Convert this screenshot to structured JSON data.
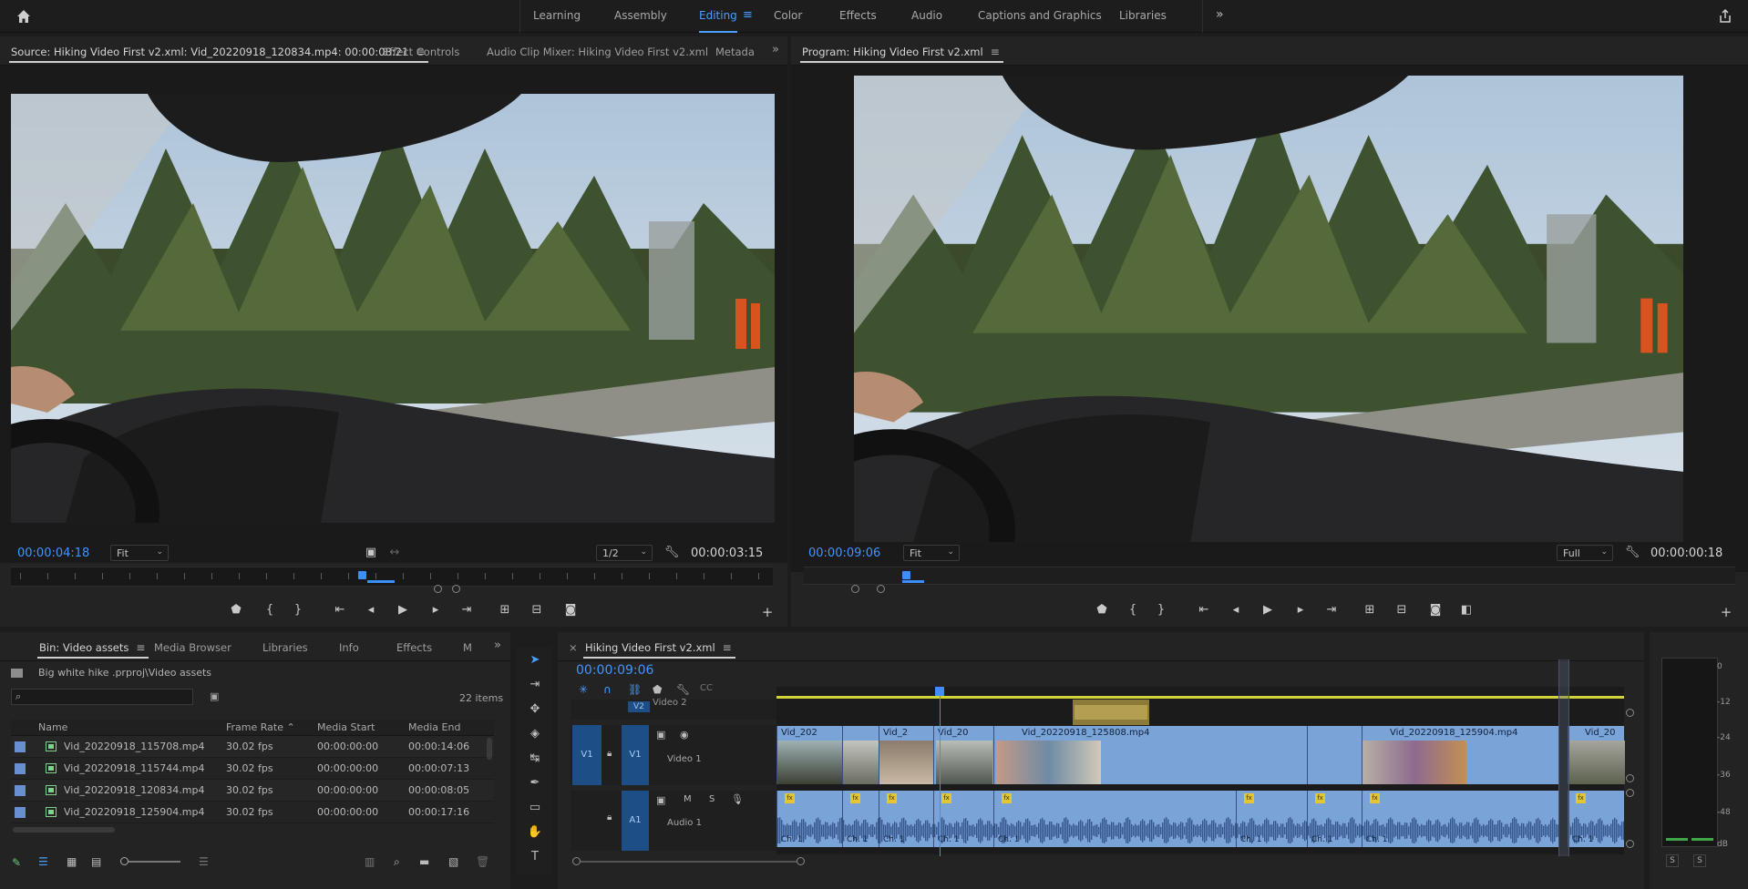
{
  "workspaces": {
    "tabs": [
      "Learning",
      "Assembly",
      "Editing",
      "Color",
      "Effects",
      "Audio",
      "Captions and Graphics",
      "Libraries"
    ],
    "active": "Editing"
  },
  "source": {
    "tabs": {
      "source": "Source: Hiking Video First v2.xml: Vid_20220918_120834.mp4: 00:00:08:21",
      "effect_controls": "Effect Controls",
      "audio_mixer": "Audio Clip Mixer: Hiking Video First v2.xml",
      "metadata": "Metada"
    },
    "timecode": "00:00:04:18",
    "fit": "Fit",
    "resolution": "1/2",
    "duration": "00:00:03:15",
    "playhead_fraction": 0.46
  },
  "program": {
    "title": "Program: Hiking Video First v2.xml",
    "timecode": "00:00:09:06",
    "fit": "Fit",
    "resolution": "Full",
    "duration": "00:00:00:18"
  },
  "project": {
    "tabs": {
      "bin": "Bin: Video assets",
      "media_browser": "Media Browser",
      "libraries": "Libraries",
      "info": "Info",
      "effects": "Effects",
      "more": "M"
    },
    "path": "Big white hike .prproj\\Video assets",
    "item_count": "22 items",
    "columns": [
      "Name",
      "Frame Rate",
      "Media Start",
      "Media End"
    ],
    "rows": [
      {
        "name": "Vid_20220918_115708.mp4",
        "fps": "30.02 fps",
        "start": "00:00:00:00",
        "end": "00:00:14:06"
      },
      {
        "name": "Vid_20220918_115744.mp4",
        "fps": "30.02 fps",
        "start": "00:00:00:00",
        "end": "00:00:07:13"
      },
      {
        "name": "Vid_20220918_120834.mp4",
        "fps": "30.02 fps",
        "start": "00:00:00:00",
        "end": "00:00:08:05"
      },
      {
        "name": "Vid_20220918_125904.mp4",
        "fps": "30.02 fps",
        "start": "00:00:00:00",
        "end": "00:00:17:16"
      }
    ]
  },
  "timeline": {
    "title": "Hiking Video First v2.xml",
    "timecode": "00:00:09:06",
    "tracks": {
      "v2_label": "Video 2",
      "v2_code": "V2",
      "v1_label": "Video 1",
      "v1_code": "V1",
      "a1_label": "Audio 1",
      "a1_code": "A1",
      "mute": "M",
      "solo": "S"
    },
    "video_clips": [
      "Vid_202",
      "Vid_2",
      "Vid_20",
      "Vid_20220918_125808.mp4",
      "Vid_20220918_125904.mp4",
      "Vid_20"
    ],
    "audio_channel_label": "Ch. 1",
    "fx_label": "fx"
  },
  "meter": {
    "labels": [
      "0",
      "-12",
      "-24",
      "-36",
      "-48",
      "dB"
    ],
    "solo_buttons": [
      "S",
      "S"
    ]
  }
}
